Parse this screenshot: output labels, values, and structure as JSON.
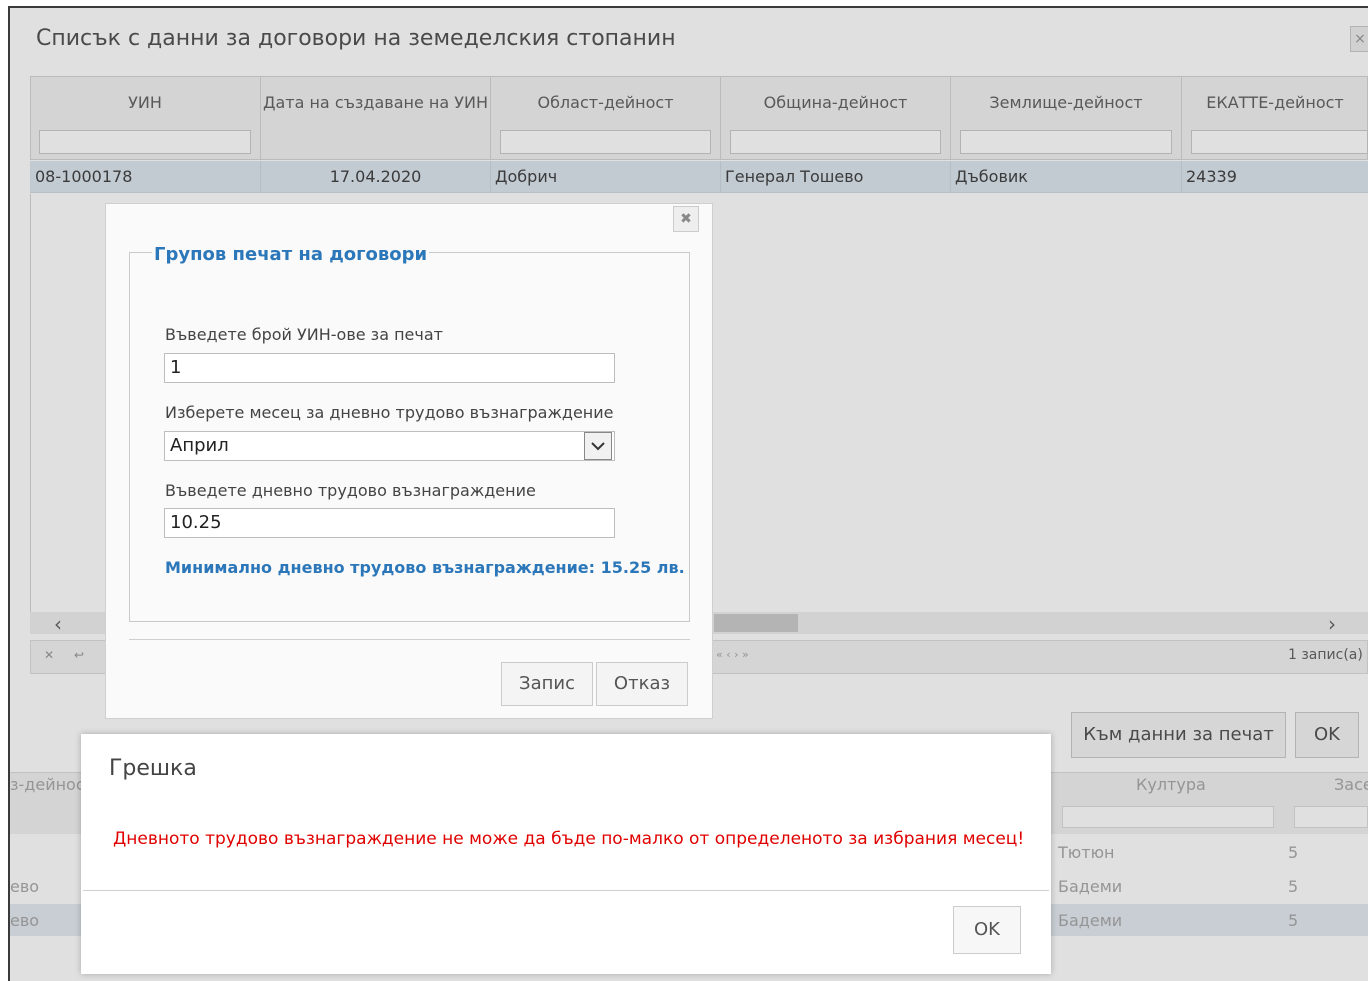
{
  "page": {
    "title": "Списък с данни за договори на земеделския стопанин",
    "close_icon": "x-icon"
  },
  "grid": {
    "columns": [
      "УИН",
      "Дата на създаване на УИН",
      "Област-дейност",
      "Община-дейност",
      "Землище-дейност",
      "ЕКАТТЕ-дейност"
    ],
    "rows": [
      [
        "08-1000178",
        "17.04.2020",
        "Добрич",
        "Генерал Тошево",
        "Дъбовик",
        "24339"
      ]
    ],
    "records_text": "1 запис(а)"
  },
  "actions": {
    "print_data": "Към данни за печат",
    "ok": "OK"
  },
  "lower_grid": {
    "left_header_fragment": "з-дейнос",
    "left_cells": [
      "ево",
      "ево"
    ],
    "culture_header": "Култура",
    "right_header_fragment": "Засе",
    "cultures": [
      "Тютюн",
      "Бадеми",
      "Бадеми"
    ],
    "counts": [
      "5",
      "5",
      "5"
    ]
  },
  "dialog": {
    "legend": "Групов печат на договори",
    "count_label": "Въведете брой УИН-ове за печат",
    "count_value": "1",
    "month_label": "Изберете месец за дневно трудово възнаграждение",
    "month_value": "Април",
    "wage_label": "Въведете дневно трудово възнаграждение",
    "wage_value": "10.25",
    "min_hint": "Минимално дневно трудово възнаграждение: 15.25 лв.",
    "save": "Запис",
    "cancel": "Отказ"
  },
  "error": {
    "title": "Грешка",
    "message": "Дневното трудово възнаграждение не може да бъде по-малко от определеното за избрания месец!",
    "ok": "OK"
  }
}
